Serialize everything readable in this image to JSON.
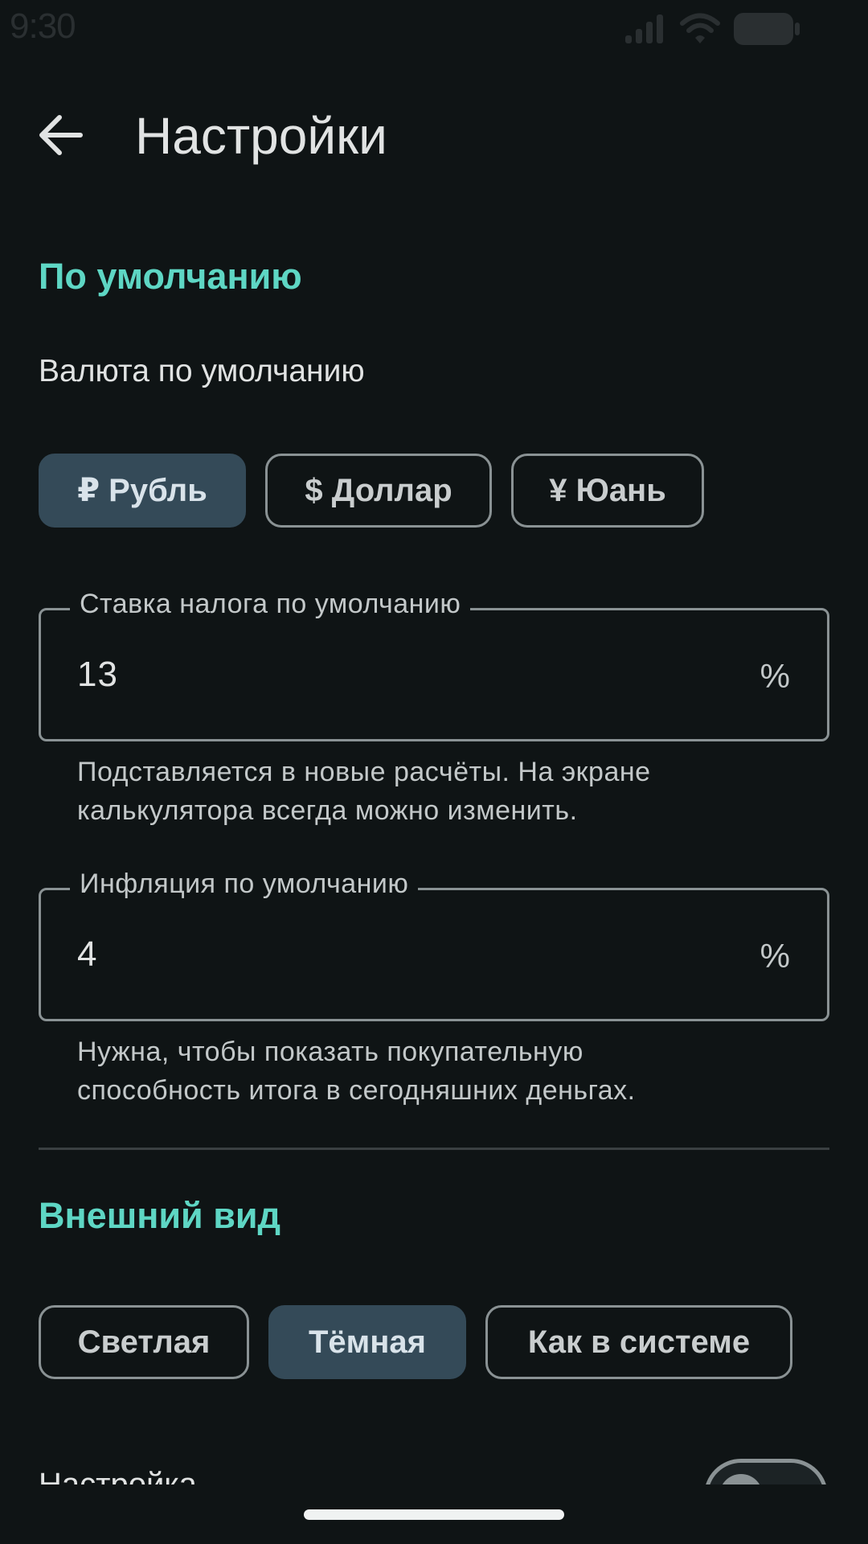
{
  "status_bar": {
    "time": "9:30",
    "icons": [
      "signal-icon",
      "wifi-icon",
      "battery-icon"
    ]
  },
  "header": {
    "back_icon": "arrow-left-icon",
    "title": "Настройки"
  },
  "defaults_section": {
    "title": "По умолчанию",
    "currency_label": "Валюта по умолчанию",
    "currency_chips": [
      {
        "label": "₽ Рубль",
        "selected": true
      },
      {
        "label": "$ Доллар",
        "selected": false
      },
      {
        "label": "¥ Юань",
        "selected": false
      }
    ],
    "tax_field": {
      "label": "Ставка налога по умолчанию",
      "value": "13",
      "suffix": "%",
      "helper_line1": "Подставляется в новые расчёты. На экране",
      "helper_line2": "калькулятора всегда можно изменить."
    },
    "inflation_field": {
      "label": "Инфляция по умолчанию",
      "value": "4",
      "suffix": "%",
      "helper_line1": "Нужна, чтобы показать покупательную",
      "helper_line2": "способность итога в сегодняшних деньгах."
    }
  },
  "appearance_section": {
    "title": "Внешний вид",
    "theme_chips": [
      {
        "label": "Светлая",
        "selected": false
      },
      {
        "label": "Тёмная",
        "selected": true
      },
      {
        "label": "Как в системе",
        "selected": false
      }
    ]
  },
  "colors": {
    "background": "#0F1415",
    "accent": "#5ED6C4",
    "chip_selected": "#344A58",
    "outline": "#8A9294"
  }
}
